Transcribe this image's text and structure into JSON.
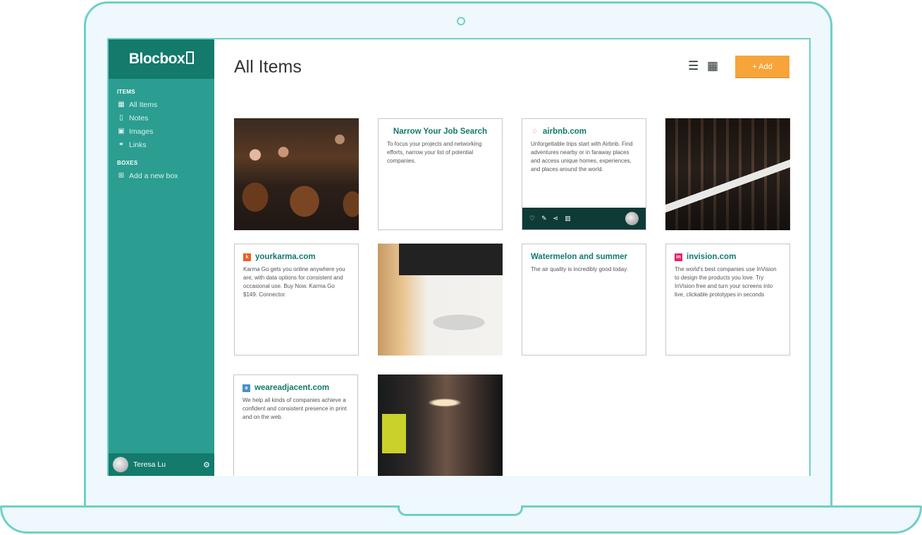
{
  "app": {
    "name": "Blocbox"
  },
  "page": {
    "title": "All Items"
  },
  "toolbar": {
    "add_label": "+ Add"
  },
  "sidebar": {
    "items_heading": "ITEMS",
    "items": [
      {
        "label": "All Items",
        "icon": "grid-icon"
      },
      {
        "label": "Notes",
        "icon": "note-icon"
      },
      {
        "label": "Images",
        "icon": "image-icon"
      },
      {
        "label": "Links",
        "icon": "link-icon"
      }
    ],
    "boxes_heading": "BOXES",
    "add_box_label": "Add a new box"
  },
  "user": {
    "name": "Teresa Lu"
  },
  "cards": {
    "narrow": {
      "title": "Narrow Your Job Search",
      "text": "To focus your projects and networking efforts, narrow your list of potential companies."
    },
    "airbnb": {
      "title": "airbnb.com",
      "text": "Unforgettable trips start with Airbnb. Find adventures nearby or in faraway places and access unique homes, experiences, and places around the world."
    },
    "yourkarma": {
      "title": "yourkarma.com",
      "text": "Karma Go gets you online anywhere you are, with data options for consistent and occasional use. Buy Now. Karma Go $149. Connector."
    },
    "watermelon": {
      "title": "Watermelon and summer",
      "text": "The air quality is incredibly good today."
    },
    "invision": {
      "title": "invision.com",
      "text": "The world's best companies use InVision to design the products you love. Try InVision free and turn your screens into live, clickable prototypes in seconds"
    },
    "weareadjacent": {
      "title": "weareadjacent.com",
      "text": "We help all kinds of companies achieve a confident and consistent presence in print and on the web."
    }
  },
  "colors": {
    "sidebar": "#2b9e91",
    "sidebar_dark": "#137a6c",
    "accent": "#f7a43a",
    "frame": "#6fd0c6"
  }
}
